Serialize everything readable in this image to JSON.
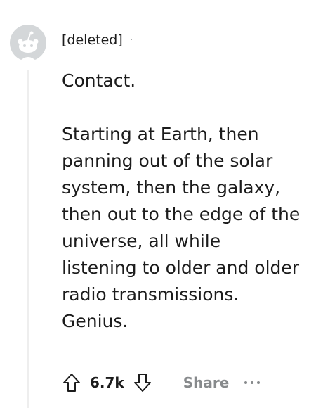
{
  "comment": {
    "author": "[deleted]",
    "separator": "·",
    "paragraphs": [
      "Contact.",
      "Starting at Earth, then panning out of the solar system, then the galaxy, then out to the edge of the universe, all while listening to older and older radio transmissions. Genius."
    ],
    "score": "6.7k",
    "share_label": "Share"
  },
  "icons": {
    "avatar": "snoo-avatar-icon",
    "upvote": "upvote-arrow-icon",
    "downvote": "downvote-arrow-icon",
    "more": "more-options-icon"
  },
  "colors": {
    "text": "#1c1c1c",
    "muted": "#878a8c",
    "avatar": "#d4d7d9",
    "thread_line": "#eeeeee"
  }
}
